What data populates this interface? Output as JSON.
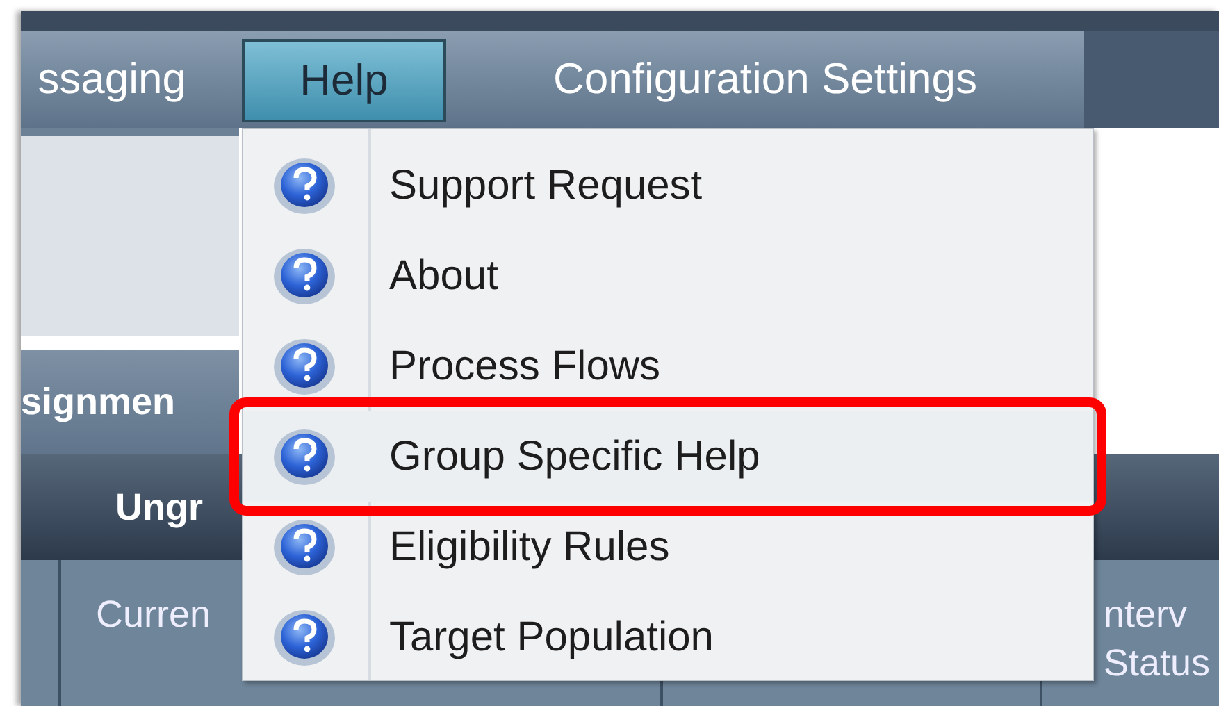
{
  "menu_bar": {
    "items": [
      {
        "label": "ssaging",
        "selected": false
      },
      {
        "label": "Help",
        "selected": true
      },
      {
        "label": "Configuration Settings",
        "selected": false
      }
    ]
  },
  "tabs": [
    {
      "label": "signmen"
    }
  ],
  "section_header": {
    "title": "Ungr"
  },
  "table": {
    "columns": [
      {
        "label": "Curren"
      },
      {
        "label": "nterv Status"
      }
    ]
  },
  "help_menu": {
    "items": [
      {
        "label": "Support Request",
        "highlighted": false
      },
      {
        "label": "About",
        "highlighted": false
      },
      {
        "label": "Process Flows",
        "highlighted": false
      },
      {
        "label": "Group Specific Help",
        "highlighted": true
      },
      {
        "label": "Eligibility Rules",
        "highlighted": false
      },
      {
        "label": "Target Population",
        "highlighted": false
      }
    ]
  }
}
